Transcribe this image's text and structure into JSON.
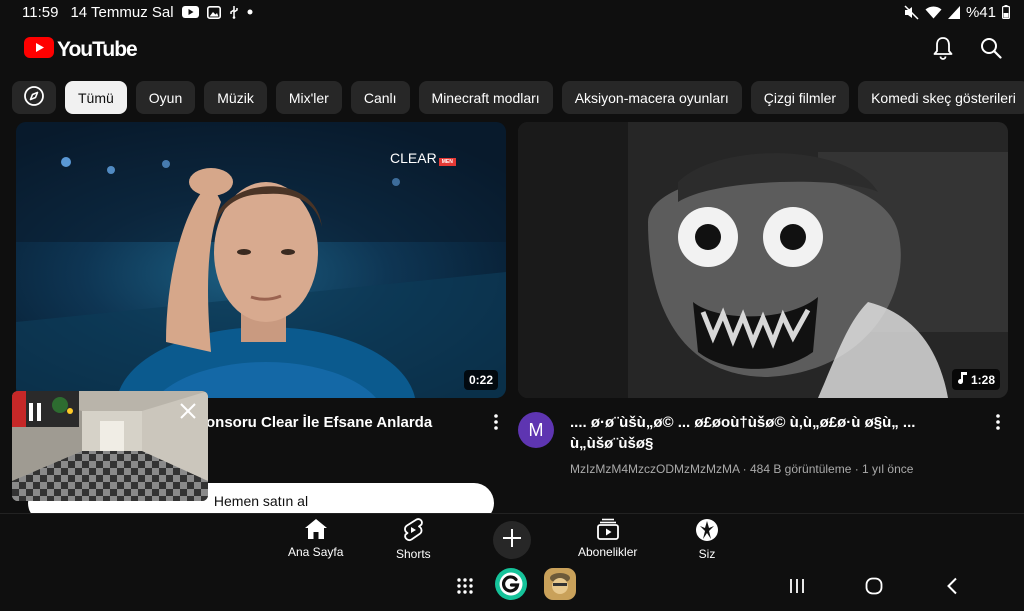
{
  "status_bar": {
    "time": "11:59",
    "date": "14 Temmuz Sal",
    "battery": "%41"
  },
  "header": {
    "app_name": "YouTube"
  },
  "chips": [
    {
      "label": "Tümü",
      "active": true
    },
    {
      "label": "Oyun"
    },
    {
      "label": "Müzik"
    },
    {
      "label": "Mix'ler"
    },
    {
      "label": "Canlı"
    },
    {
      "label": "Minecraft modları"
    },
    {
      "label": "Aksiyon-macera oyunları"
    },
    {
      "label": "Çizgi filmler"
    },
    {
      "label": "Komedi skeç gösterileri"
    }
  ],
  "videos": [
    {
      "thumb_text": "CLEAR",
      "thumb_badge": "MEN",
      "duration": "0:22",
      "title": "onsoru Clear İle Efsane Anlarda"
    },
    {
      "duration": "1:28",
      "avatar_letter": "M",
      "title": ".... ø·ø¨ùšù„ø© ... ø£øoù†ùšø© ù‚ù„ø£ø·ù ø§ù„ ... ù„ùšø¨ùšø§",
      "subtitle": "MzIzMzM4MzczODMzMzMzMA · 484 B görüntüleme · 1 yıl önce"
    }
  ],
  "buy_button": {
    "label": "Hemen satın al"
  },
  "bottom_nav": [
    {
      "label": "Ana Sayfa",
      "icon": "home-icon"
    },
    {
      "label": "Shorts",
      "icon": "shorts-icon"
    },
    {
      "label": "Abonelikler",
      "icon": "subscriptions-icon"
    },
    {
      "label": "Siz",
      "icon": "account-icon"
    }
  ],
  "colors": {
    "background": "#0f0f0f",
    "chip": "#272727",
    "chip_active": "#f1f1f1",
    "brand_red": "#ff0000",
    "avatar": "#5e35b1",
    "secondary_text": "#aaaaaa"
  }
}
